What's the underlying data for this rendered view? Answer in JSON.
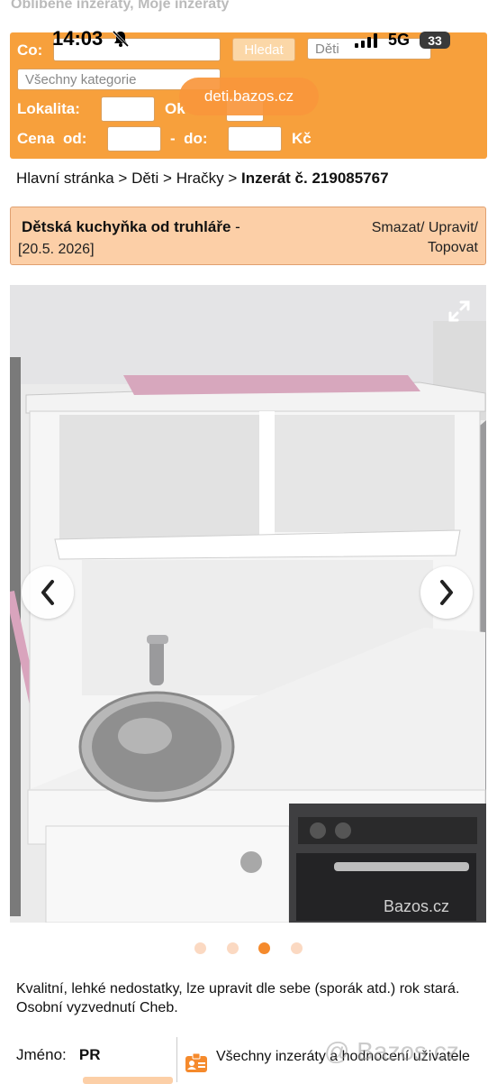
{
  "top_links": "Oblíbené inzeráty, Moje inzeráty",
  "status_bar": {
    "time": "14:03",
    "network": "5G",
    "battery": "33"
  },
  "browser": {
    "url": "deti.bazos.cz"
  },
  "search": {
    "co_label": "Co:",
    "search_button": "Hledat",
    "section_select": "Děti",
    "category_select": "Všechny kategorie",
    "lokalita_label": "Lokalita:",
    "okruh_label": "Ok",
    "cena_od_label": "Cena  od:",
    "cena_do_label": "-  do:",
    "currency": "Kč"
  },
  "breadcrumb": {
    "home": "Hlavní stránka",
    "sep1": ">",
    "section": "Děti",
    "sep2": ">",
    "category": "Hračky",
    "sep3": ">",
    "current": "Inzerát č. 219085767"
  },
  "listing": {
    "title": "Dětská kuchyňka od truhláře",
    "title_dash": " -",
    "date": "[20.5. 2026]",
    "action_1": "Smazat/ Upravit/",
    "action_2": "Topovat"
  },
  "gallery": {
    "watermark": "Bazos.cz",
    "image_count": 4,
    "active_index": 2
  },
  "description": "Kvalitní, lehké nedostatky, lze upravit dle sebe (sporák atd.) rok stará. Osobní vyzvednutí Cheb.",
  "seller": {
    "name_label": "Jméno:",
    "name_value": "PR",
    "all_listings_link": "Všechny inzeráty a hodnocení uživatele"
  },
  "page_watermark": "Bazos.cz",
  "colors": {
    "accent": "#f7a03c",
    "title_bg": "#fccfa7",
    "dot_active": "#f58a2c"
  }
}
